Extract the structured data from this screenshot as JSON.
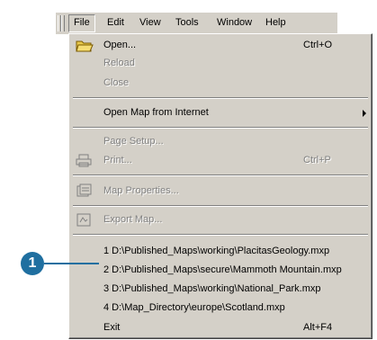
{
  "menubar": {
    "items": [
      {
        "label": "File"
      },
      {
        "label": "Edit"
      },
      {
        "label": "View"
      },
      {
        "label": "Tools"
      },
      {
        "label": "Window"
      },
      {
        "label": "Help"
      }
    ]
  },
  "file_menu": {
    "open": {
      "label": "Open...",
      "shortcut": "Ctrl+O",
      "icon": "open-folder-icon"
    },
    "reload": {
      "label": "Reload"
    },
    "close": {
      "label": "Close"
    },
    "open_map_internet": {
      "label": "Open Map from Internet"
    },
    "page_setup": {
      "label": "Page Setup..."
    },
    "print": {
      "label": "Print...",
      "shortcut": "Ctrl+P",
      "icon": "printer-icon"
    },
    "map_properties": {
      "label": "Map Properties...",
      "icon": "map-properties-icon"
    },
    "export_map": {
      "label": "Export Map...",
      "icon": "export-map-icon"
    },
    "recent_files": [
      "1 D:\\Published_Maps\\working\\PlacitasGeology.mxp",
      "2 D:\\Published_Maps\\secure\\Mammoth Mountain.mxp",
      "3 D:\\Published_Maps\\working\\National_Park.mxp",
      "4 D:\\Map_Directory\\europe\\Scotland.mxp"
    ],
    "exit": {
      "label": "Exit",
      "shortcut": "Alt+F4"
    }
  },
  "callout": {
    "number": "1"
  }
}
